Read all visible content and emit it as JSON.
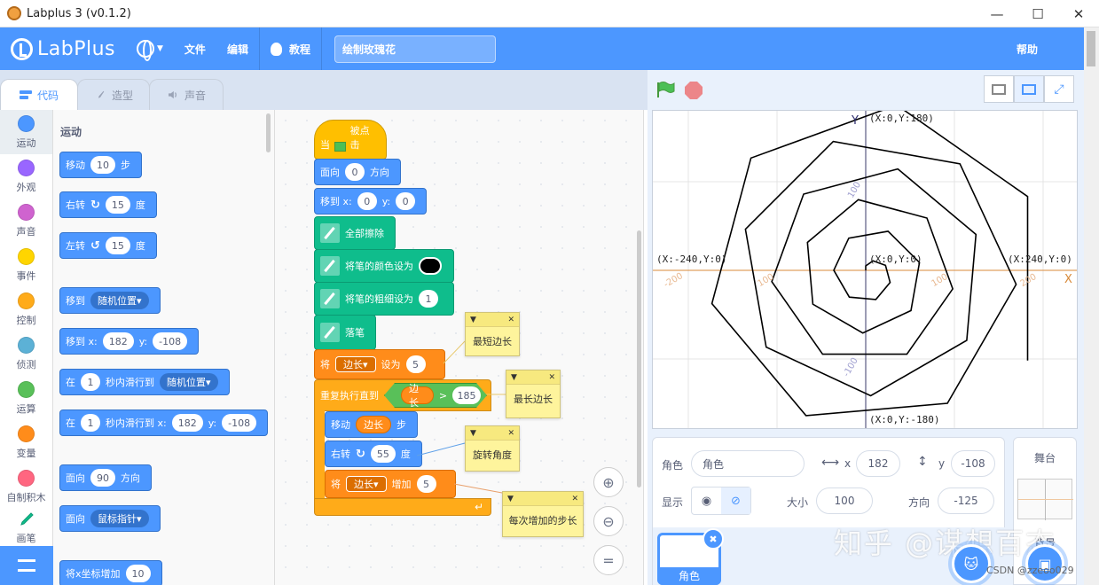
{
  "window": {
    "title": "Labplus 3 (v0.1.2)",
    "minimize": "—",
    "maximize": "☐",
    "close": "✕"
  },
  "menubar": {
    "logo": "LabPlus",
    "file": "文件",
    "edit": "编辑",
    "tutorial": "教程",
    "project_title": "绘制玫瑰花",
    "help": "帮助"
  },
  "tabs": [
    {
      "label": "代码"
    },
    {
      "label": "造型"
    },
    {
      "label": "声音"
    }
  ],
  "categories": [
    {
      "label": "运动",
      "color": "#4c97ff"
    },
    {
      "label": "外观",
      "color": "#9966ff"
    },
    {
      "label": "声音",
      "color": "#cf63cf"
    },
    {
      "label": "事件",
      "color": "#ffd500"
    },
    {
      "label": "控制",
      "color": "#ffab19"
    },
    {
      "label": "侦测",
      "color": "#5cb1d6"
    },
    {
      "label": "运算",
      "color": "#59c059"
    },
    {
      "label": "变量",
      "color": "#ff8c1a"
    },
    {
      "label": "自制积木",
      "color": "#ff6680"
    },
    {
      "label": "画笔",
      "color": "#0fbd8c"
    }
  ],
  "palette": {
    "header": "运动",
    "move": {
      "pre": "移动",
      "val": "10",
      "post": "步"
    },
    "turn_right": {
      "pre": "右转",
      "val": "15",
      "post": "度"
    },
    "turn_left": {
      "pre": "左转",
      "val": "15",
      "post": "度"
    },
    "goto_random": {
      "pre": "移到",
      "dd": "随机位置"
    },
    "goto_xy": {
      "pre": "移到 x:",
      "x": "182",
      "ylabel": "y:",
      "y": "-108"
    },
    "glide_random": {
      "pre": "在",
      "val": "1",
      "mid": "秒内滑行到",
      "dd": "随机位置"
    },
    "glide_xy": {
      "pre": "在",
      "val": "1",
      "mid": "秒内滑行到 x:",
      "x": "182",
      "ylabel": "y:",
      "y": "-108"
    },
    "point_dir": {
      "pre": "面向",
      "val": "90",
      "post": "方向"
    },
    "point_towards": {
      "pre": "面向",
      "dd": "鼠标指针"
    },
    "change_x": {
      "pre": "将x坐标增加",
      "val": "10"
    }
  },
  "script": {
    "hat": {
      "pre": "当",
      "post": "被点击"
    },
    "point": {
      "pre": "面向",
      "val": "0",
      "post": "方向"
    },
    "goto": {
      "pre": "移到 x:",
      "x": "0",
      "ylabel": "y:",
      "y": "0"
    },
    "clear": "全部擦除",
    "set_color": "将笔的颜色设为",
    "set_size": {
      "label": "将笔的粗细设为",
      "val": "1"
    },
    "pen_down": "落笔",
    "set_var": {
      "pre": "将",
      "var": "边长",
      "mid": "设为",
      "val": "5"
    },
    "repeat_until": "重复执行直到",
    "cond": {
      "var": "边长",
      "op": ">",
      "val": "185"
    },
    "move": {
      "pre": "移动",
      "var": "边长",
      "post": "步"
    },
    "turn": {
      "pre": "右转",
      "val": "55",
      "post": "度"
    },
    "change_var": {
      "pre": "将",
      "var": "边长",
      "mid": "增加",
      "val": "5"
    }
  },
  "notes": [
    {
      "text": "最短边长"
    },
    {
      "text": "最长边长"
    },
    {
      "text": "旋转角度"
    },
    {
      "text": "每次增加的步长"
    }
  ],
  "stage": {
    "axis_y": "Y",
    "axis_x": "X",
    "top": "(X:0,Y:180)",
    "bottom": "(X:0,Y:-180)",
    "left": "(X:-240,Y:0)",
    "right": "(X:240,Y:0)",
    "center": "(X:0,Y:0)",
    "tick_y_pos": "100",
    "tick_y_neg": "-100",
    "tick_x_neg200": "-200",
    "tick_x_neg100": "100",
    "tick_x_pos100": "100",
    "tick_x_pos200": "200",
    "pen_color": "#000000"
  },
  "sprite_info": {
    "sprite_label": "角色",
    "sprite_name": "角色",
    "x_label": "x",
    "x": "182",
    "y_label": "y",
    "y": "-108",
    "show_label": "显示",
    "size_label": "大小",
    "size": "100",
    "dir_label": "方向",
    "dir": "-125",
    "thumb_name": "角色"
  },
  "stage_pane": {
    "label": "舞台",
    "bg_label": "背景"
  },
  "watermark": "知乎 @谋想百态",
  "csdn": "CSDN @zzeoo029"
}
